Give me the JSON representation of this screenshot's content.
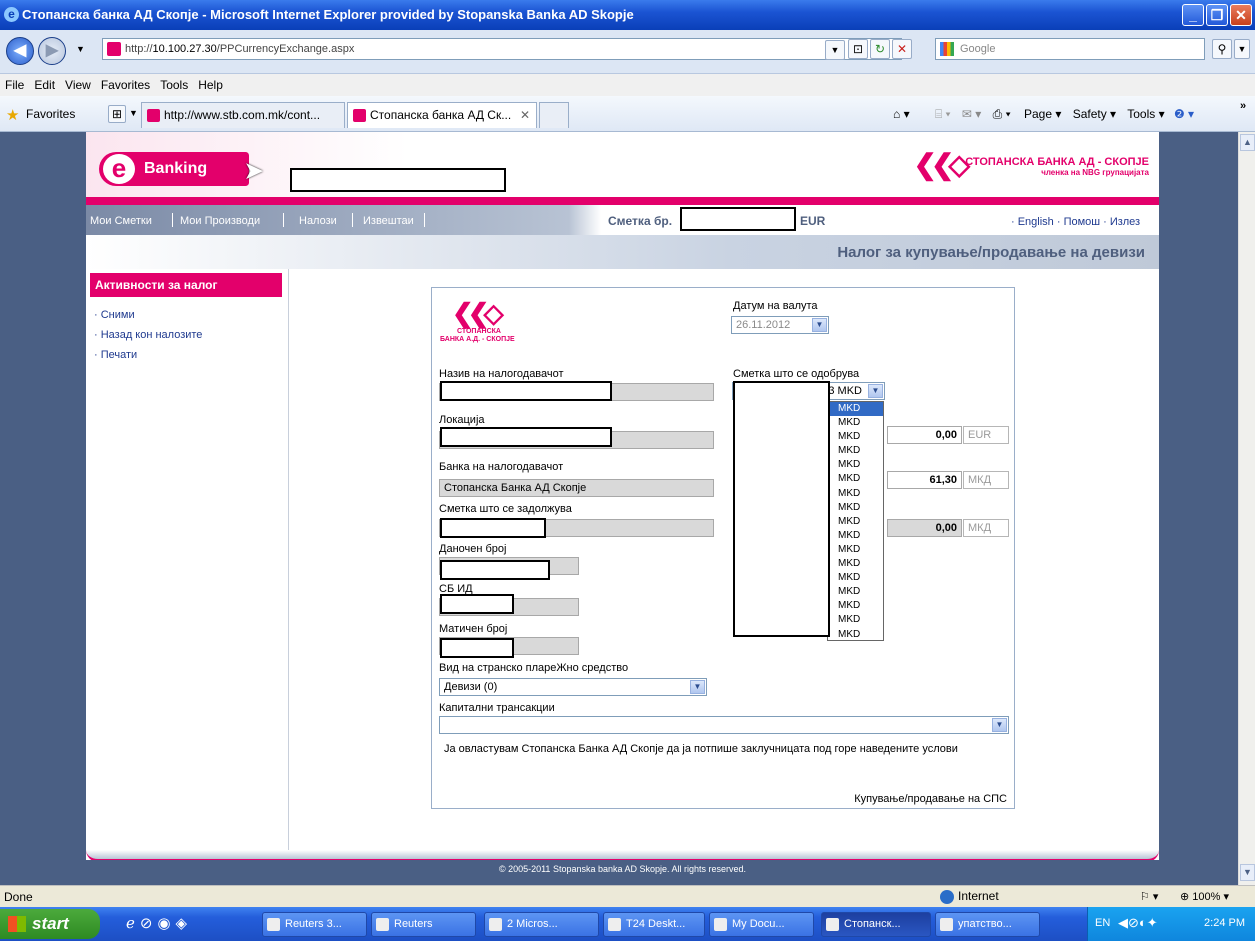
{
  "window": {
    "title": "Стопанска банка АД Скопје - Microsoft Internet Explorer provided by Stopanska Banka AD Skopje"
  },
  "address": {
    "url_prefix": "http://",
    "url_host": "10.100.27.30",
    "url_path": "/PPCurrencyExchange.aspx",
    "search_placeholder": "Google"
  },
  "menu": [
    "File",
    "Edit",
    "View",
    "Favorites",
    "Tools",
    "Help"
  ],
  "favbar": {
    "favorites_label": "Favorites",
    "tabs": [
      {
        "label": "http://www.stb.com.mk/cont..."
      },
      {
        "label": "Стопанска банка АД Ск..."
      }
    ],
    "commands": [
      "Page ▾",
      "Safety ▾",
      "Tools ▾"
    ]
  },
  "bank": {
    "ebanking_label": "Banking",
    "brand_name": "СТОПАНСКА БАНКА АД - СКОПЈЕ",
    "brand_sub": "членка на NBG групацијата",
    "nav": [
      "Мои Сметки",
      "Мои Производи",
      "Налози",
      "Извештаи"
    ],
    "account_label": "Сметка бр.",
    "account_currency": "EUR",
    "top_links": [
      "· English",
      "· Помош",
      "· Излез"
    ],
    "page_title": "Налог за купување/продавање на девизи",
    "colors": {
      "brand_pink": "#e3006b",
      "nav_blue": "#4a5f84"
    }
  },
  "sidebar": {
    "header": "Активности за налог",
    "links": [
      "· Сними",
      "· Назад кон налозите",
      "· Печати"
    ]
  },
  "form": {
    "logo_line1": "СТОПАНСКА",
    "logo_line2": "БАНКА А.Д. - СКОПЈЕ",
    "value_date_label": "Датум на валута",
    "value_date": "26.11.2012",
    "orderer_name_label": "Назив на налогодавачот",
    "location_label": "Локација",
    "orderer_bank_label": "Банка на налогодавачот",
    "orderer_bank_value": "Стопанска Банка АД Скопје",
    "debit_account_label": "Сметка што се задолжува",
    "tax_number_label": "Даночен број",
    "sb_id_label": "СБ ИД",
    "reg_number_label": "Матичен број",
    "payment_type_label": "Вид на странско плареЖно средство",
    "payment_type_value": "Девизи (0)",
    "capital_label": "Капитални трансакции",
    "capital_value": "",
    "credit_account_label": "Сметка што се одобрува",
    "credit_account_value": "3 MKD",
    "amount1": "0,00",
    "amount1_cur": "EUR",
    "amount2": "61,30",
    "amount2_cur": "МКД",
    "amount3": "0,00",
    "amount3_cur": "МКД",
    "authorization_text": "Ја овластувам Стопанска Банка АД Скопје да ја потпише заклучницата под горе наведените услови",
    "footer_link": "Купување/продавање на СПС",
    "dropdown_options": [
      "MKD",
      "MKD",
      "MKD",
      "MKD",
      "MKD",
      "MKD",
      "MKD",
      "MKD",
      "MKD",
      "MKD",
      "MKD",
      "MKD",
      "MKD",
      "MKD",
      "MKD",
      "MKD",
      "MKD"
    ]
  },
  "copyright": "© 2005-2011 Stopanska banka AD Skopje. All rights reserved.",
  "status": {
    "text": "Done",
    "zone": "Internet",
    "zoom": "100%"
  },
  "taskbar": {
    "start": "start",
    "tasks": [
      "Reuters 3...",
      "Reuters",
      "2 Micros...",
      "T24 Deskt...",
      "My Docu...",
      "Стопанск...",
      "упатство..."
    ],
    "lang": "EN",
    "clock": "2:24 PM"
  }
}
